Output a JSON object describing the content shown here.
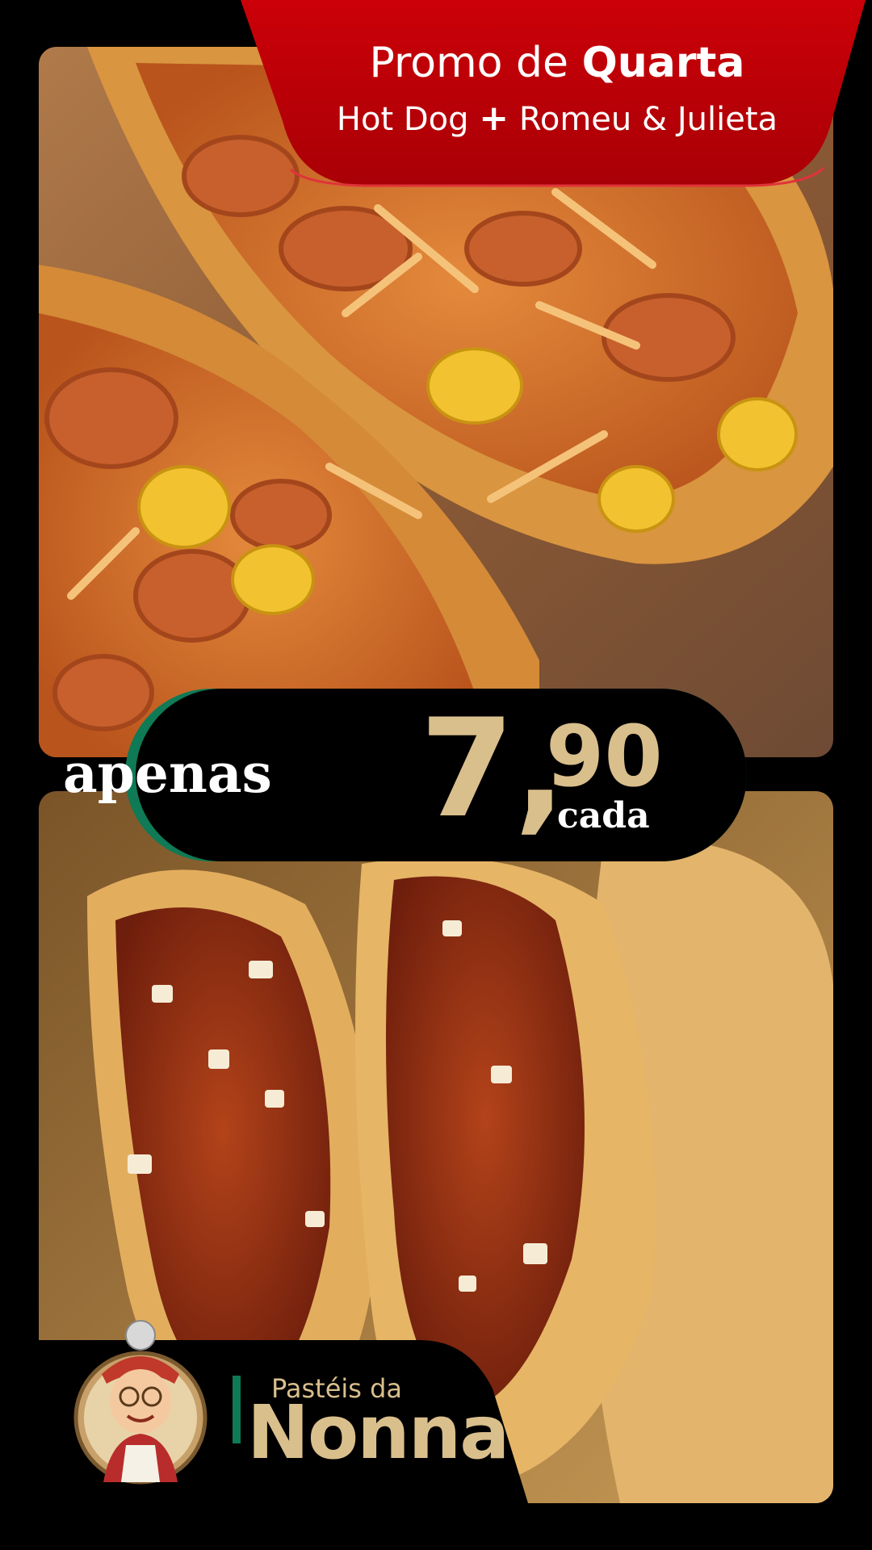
{
  "promo": {
    "line1_prefix": "Promo de",
    "line1_day": "Quarta",
    "line2_item1": "Hot Dog",
    "line2_plus": "+",
    "line2_item2": "Romeu & Julieta"
  },
  "price": {
    "prefix": "apenas",
    "integer": "7,",
    "cents": "90",
    "unit": "cada"
  },
  "brand": {
    "name_top": "Pastéis da",
    "name_bottom": "Nonna"
  },
  "colors": {
    "banner_red": "#c0000c",
    "gold": "#d9bf8c",
    "accent_green": "#0f7a55",
    "background": "#000000"
  }
}
